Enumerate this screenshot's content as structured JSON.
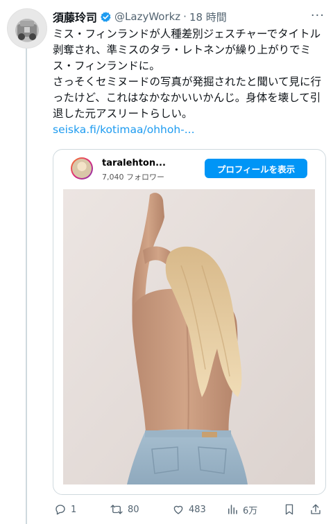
{
  "tweet": {
    "display_name": "須藤玲司",
    "handle": "@LazyWorkz",
    "separator": "·",
    "time": "18 時間",
    "more": "···",
    "lines": [
      "ミス・フィンランドが人種差別ジェスチャーでタイトル剥奪され、準ミスのタラ・レトネンが繰り上がりでミス・フィンランドに。",
      "さっそくセミヌードの写真が発掘されたと聞いて見に行ったけど、これはなかなかいいかんじ。身体を壊して引退した元アスリートらしい。"
    ],
    "link": "seiska.fi/kotimaa/ohhoh-..."
  },
  "embed": {
    "username": "taralehton...",
    "followers": "7,040 フォロワー",
    "profile_button": "プロフィールを表示"
  },
  "actions": {
    "replies": "1",
    "retweets": "80",
    "likes": "483",
    "views": "6万"
  },
  "colors": {
    "accent": "#1d9bf0",
    "instagram_button": "#0095f6",
    "secondary_text": "#536471"
  }
}
